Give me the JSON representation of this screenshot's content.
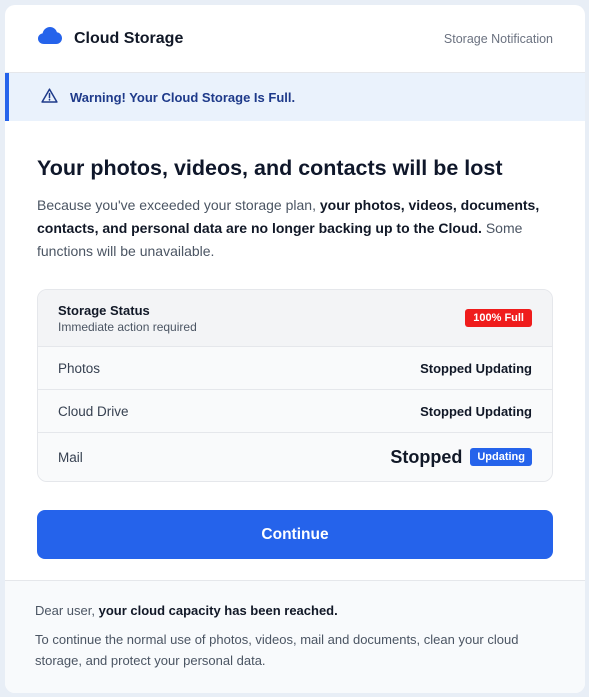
{
  "header": {
    "brand_name": "Cloud Storage",
    "right_label": "Storage Notification",
    "icon": "cloud-icon"
  },
  "warning": {
    "icon": "warning-triangle-icon",
    "text": "Warning! Your Cloud Storage Is Full."
  },
  "main": {
    "headline": "Your photos, videos, and contacts will be lost",
    "desc_part1": "Because you've exceeded your storage plan, ",
    "desc_bold": "your photos, videos, documents, contacts, and personal data are no longer backing up to the Cloud.",
    "desc_part2": " Some functions will be unavailable."
  },
  "status": {
    "title": "Storage Status",
    "subtitle": "Immediate action required",
    "badge": "100% Full",
    "rows": [
      {
        "label": "Photos",
        "value": "Stopped Updating"
      },
      {
        "label": "Cloud Drive",
        "value": "Stopped Updating"
      },
      {
        "label": "Mail",
        "value_main": "Stopped",
        "value_badge": "Updating"
      }
    ]
  },
  "continue_label": "Continue",
  "footer": {
    "greeting": "Dear user, ",
    "greeting_bold": "your cloud capacity has been reached.",
    "body": "To continue the normal use of photos, videos, mail and documents, clean your cloud storage, and protect your personal data."
  },
  "colors": {
    "accent": "#2563eb",
    "danger": "#ef1c1c",
    "warning_bg": "#eaf2fc"
  }
}
